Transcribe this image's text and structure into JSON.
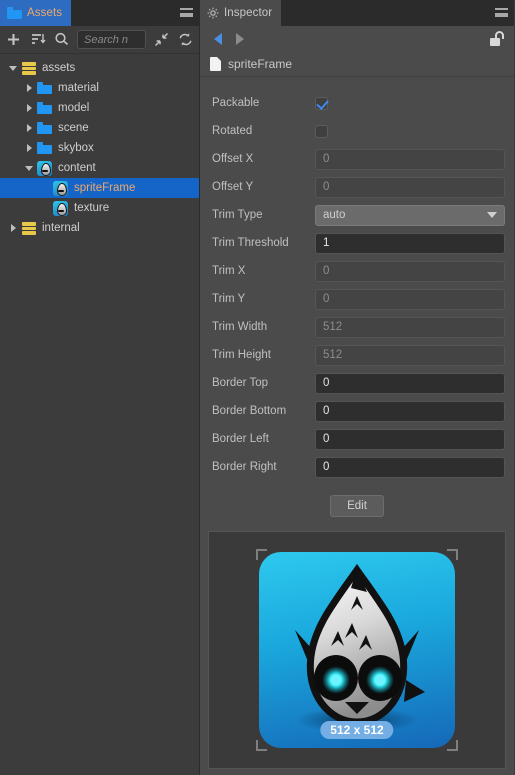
{
  "assets_panel": {
    "tab": {
      "label": "Assets",
      "icon": "folder-icon"
    },
    "menu_icon": "hamburger-menu-icon",
    "toolbar": {
      "add_icon": "plus-icon",
      "sort_icon": "sort-icon",
      "filter_icon": "search-filter-icon",
      "collapse_icon": "collapse-all-icon",
      "refresh_icon": "refresh-icon",
      "search_placeholder": "Search n"
    },
    "tree": [
      {
        "label": "assets",
        "icon": "database-icon",
        "depth": 0,
        "twisty": "open",
        "selected": false
      },
      {
        "label": "material",
        "icon": "folder-icon",
        "depth": 1,
        "twisty": "closed",
        "selected": false
      },
      {
        "label": "model",
        "icon": "folder-icon",
        "depth": 1,
        "twisty": "closed",
        "selected": false
      },
      {
        "label": "scene",
        "icon": "folder-icon",
        "depth": 1,
        "twisty": "closed",
        "selected": false
      },
      {
        "label": "skybox",
        "icon": "folder-icon",
        "depth": 1,
        "twisty": "closed",
        "selected": false
      },
      {
        "label": "content",
        "icon": "sprite-icon",
        "depth": 1,
        "twisty": "open",
        "selected": false
      },
      {
        "label": "spriteFrame",
        "icon": "sprite-icon",
        "depth": 2,
        "twisty": "none",
        "selected": true
      },
      {
        "label": "texture",
        "icon": "sprite-icon",
        "depth": 2,
        "twisty": "none",
        "selected": false
      },
      {
        "label": "internal",
        "icon": "database-icon",
        "depth": 0,
        "twisty": "closed",
        "selected": false
      }
    ]
  },
  "inspector": {
    "tab": {
      "label": "Inspector",
      "icon": "gear-icon"
    },
    "menu_icon": "hamburger-menu-icon",
    "nav": {
      "back_icon": "arrow-back-icon",
      "forward_icon": "arrow-forward-icon",
      "lock_icon": "lock-open-icon"
    },
    "asset": {
      "name": "spriteFrame",
      "icon": "file-icon"
    },
    "properties": [
      {
        "label": "Packable",
        "type": "checkbox",
        "checked": true,
        "value": ""
      },
      {
        "label": "Rotated",
        "type": "checkbox",
        "checked": false,
        "value": ""
      },
      {
        "label": "Offset X",
        "type": "number",
        "value": "0",
        "state": "dim"
      },
      {
        "label": "Offset Y",
        "type": "number",
        "value": "0",
        "state": "dim"
      },
      {
        "label": "Trim Type",
        "type": "select",
        "value": "auto",
        "state": "select"
      },
      {
        "label": "Trim Threshold",
        "type": "number",
        "value": "1",
        "state": "editable"
      },
      {
        "label": "Trim X",
        "type": "number",
        "value": "0",
        "state": "dim"
      },
      {
        "label": "Trim Y",
        "type": "number",
        "value": "0",
        "state": "dim"
      },
      {
        "label": "Trim Width",
        "type": "number",
        "value": "512",
        "state": "dim"
      },
      {
        "label": "Trim Height",
        "type": "number",
        "value": "512",
        "state": "dim"
      },
      {
        "label": "Border Top",
        "type": "number",
        "value": "0",
        "state": "editable"
      },
      {
        "label": "Border Bottom",
        "type": "number",
        "value": "0",
        "state": "editable"
      },
      {
        "label": "Border Left",
        "type": "number",
        "value": "0",
        "state": "editable"
      },
      {
        "label": "Border Right",
        "type": "number",
        "value": "0",
        "state": "editable"
      }
    ],
    "edit_button": "Edit",
    "preview": {
      "size_badge": "512 x 512",
      "image_alt": "cocos-creator-mascot-sprite"
    }
  },
  "colors": {
    "accent_blue": "#1565c8",
    "tab_text_orange": "#f0a868",
    "panel_bg": "#3c3c3c",
    "inspector_bg": "#4b4b4b",
    "checkbox_check": "#3f87f5"
  }
}
